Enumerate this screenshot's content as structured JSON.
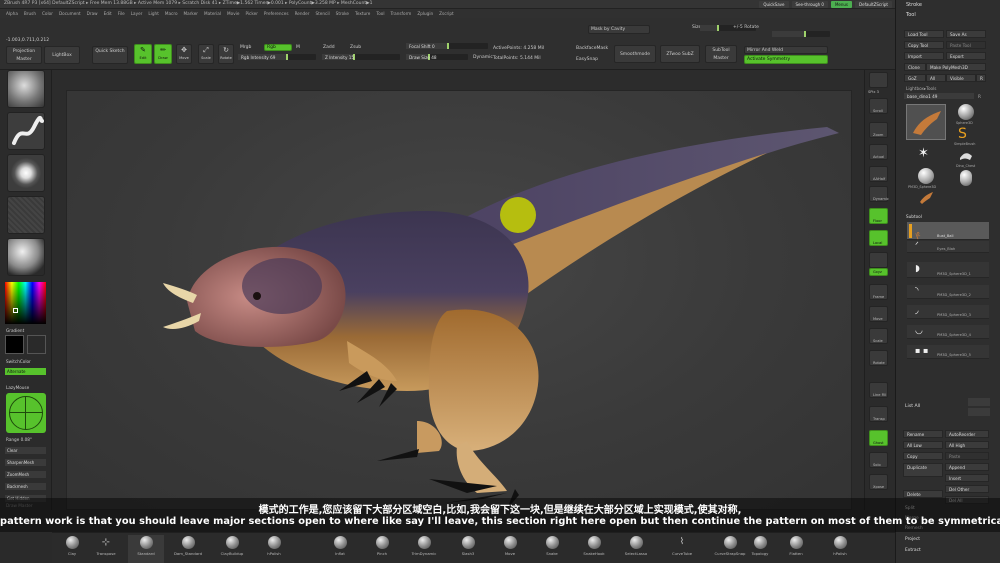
{
  "window": {
    "title": "ZBrush 4R7 P3 [x64]   DefaultZScript   ▸ Free Mem 13.88GB ▸ Active Mem 1079 ▸ Scratch Disk 41 ▸ ZTime▶1.562 Timer▶0.001 ▸ PolyCount▶3.258 MP ▸ MeshCount▶1"
  },
  "menubar": {
    "right_buttons": [
      "QuickSave",
      "See-through 0",
      "Menus",
      "DefaultZScript"
    ]
  },
  "menus": [
    "Alpha",
    "Brush",
    "Color",
    "Document",
    "Draw",
    "Edit",
    "File",
    "Layer",
    "Light",
    "Macro",
    "Marker",
    "Material",
    "Movie",
    "Picker",
    "Preferences",
    "Render",
    "Stencil",
    "Stroke",
    "Texture",
    "Tool",
    "Transform",
    "Zplugin",
    "Zscript"
  ],
  "topshelf": {
    "coords": "-1.003,0.711,0.212",
    "projection_master": "Projection Master",
    "lightbox": "LightBox",
    "quick_sketch": "Quick Sketch",
    "edit": "Edit",
    "draw": "Draw",
    "move": "Move",
    "scale": "Scale",
    "rotate": "Rotate",
    "mrgb": "Mrgb",
    "rgb": "Rgb",
    "m": "M",
    "rgb_intensity": "Rgb Intensity 69",
    "zadd": "Zadd",
    "zsub": "Zsub",
    "z_intensity": "Z Intensity 15",
    "focal_shift": "Focal Shift 0",
    "draw_size": "Draw Size 48",
    "dynamic": "Dynamic",
    "active_points": "ActivePoints: 4.258 Mil",
    "total_points": "TotalPoints: 5.144 Mil",
    "backface_mask": "BackfaceMask",
    "easy_snap": "EasySnap",
    "smoothmode": "Smoothmode",
    "ztwo_sub": "ZTwoo SubZ",
    "subtool_master": "SubTool Master",
    "mask_by_cavity": "Mask by Cavity",
    "size": "Size",
    "rotate_label": "+/-5 Rotate",
    "mirror_and_weld": "Mirror And Weld",
    "activate_symmetry": "Activate Symmetry"
  },
  "lefttray": {
    "gradient": "Gradient",
    "switch_color": "SwitchColor",
    "alternate": "Alternate",
    "lazymouse": "LazyMouse",
    "range": "Range 0.08°",
    "clear": "Clear",
    "sharpen_mesh": "SharpenMesh",
    "ZoomMesh": "ZoomMesh",
    "backmesh": "Backmesh",
    "get_hidden": "Get Hidden",
    "brush_master": "Draw Master"
  },
  "rightstrip": {
    "items": [
      "SPix 3",
      "Scroll",
      "Zoom",
      "Actual",
      "AAHalf",
      "Dynamic",
      "Persp",
      "Floor",
      "Local",
      "Gxyz",
      "Frame",
      "Move",
      "Scale",
      "Rotate",
      "Line Fill",
      "PolyF",
      "Transp",
      "Ghost",
      "Solo",
      "Xpose"
    ]
  },
  "rightpanel": {
    "stroke": "Stroke",
    "tool": "Tool",
    "load_tool": "Load Tool",
    "save_as": "Save As",
    "copy_tool": "Copy Tool",
    "paste_tool": "Paste Tool",
    "import": "Import",
    "export": "Export",
    "clone": "Clone",
    "make_polymesh": "Make PolyMesh3D",
    "goz": "GoZ",
    "all": "All",
    "visible": "Visible",
    "r": "R",
    "lightbox_tools": "Lightbox▸Tools",
    "current_tool": "base_dino1 49",
    "r_label": "R",
    "thumbs": [
      "base_dino1",
      "Sphere3D",
      "SimpleBrush",
      "PM3D_Sphere3D",
      "Dino_Chest",
      "PM3D_Sphere3D_1",
      "Cylinder3D",
      "base_dino"
    ],
    "subtool": "Subtool",
    "subtools": [
      "Bust_Ball",
      "Eyes_Blah",
      "PM3D_Sphere3D_1",
      "PM3D_Sphere3D_2",
      "PM3D_Sphere3D_3",
      "PM3D_Sphere3D_4",
      "PM3D_Sphere3D_5"
    ],
    "list_all": "List All",
    "rename": "Rename",
    "auto_reorder": "AutoReorder",
    "all_low": "All Low",
    "all_high": "All High",
    "copy": "Copy",
    "paste": "Paste",
    "duplicate": "Duplicate",
    "append": "Append",
    "insert": "Insert",
    "del_other": "Del Other",
    "delete": "Delete",
    "del_all": "Del All",
    "split": "Split",
    "merge": "Merge",
    "remesh": "Remesh",
    "project": "Project",
    "extract": "Extract"
  },
  "subtitles": {
    "chinese": "模式的工作是,您应该留下大部分区域空白,比如,我会留下这一块,但是继续在大部分区域上实现模式,使其对称,",
    "english": "pattern work is that you should leave major sections open to where like say I'll leave, this section right here open but then continue the pattern on most of them to be symmetrical,"
  },
  "bottomshelf": {
    "brushes": [
      "Clay",
      "Transpose",
      "Standard",
      "Dam_Standard",
      "ClayBuildup",
      "hPolish",
      "Inflat",
      "Pinch",
      "TrimDynamic",
      "Slash3",
      "Move",
      "Snake",
      "SnakeHook",
      "SelectLasso",
      "CurveTube",
      "CurveStrapSnap",
      "Topology",
      "Flatten",
      "hPolish"
    ]
  },
  "colors": {
    "accent_green": "#57c22c",
    "cursor_yellow": "#c8d400"
  }
}
